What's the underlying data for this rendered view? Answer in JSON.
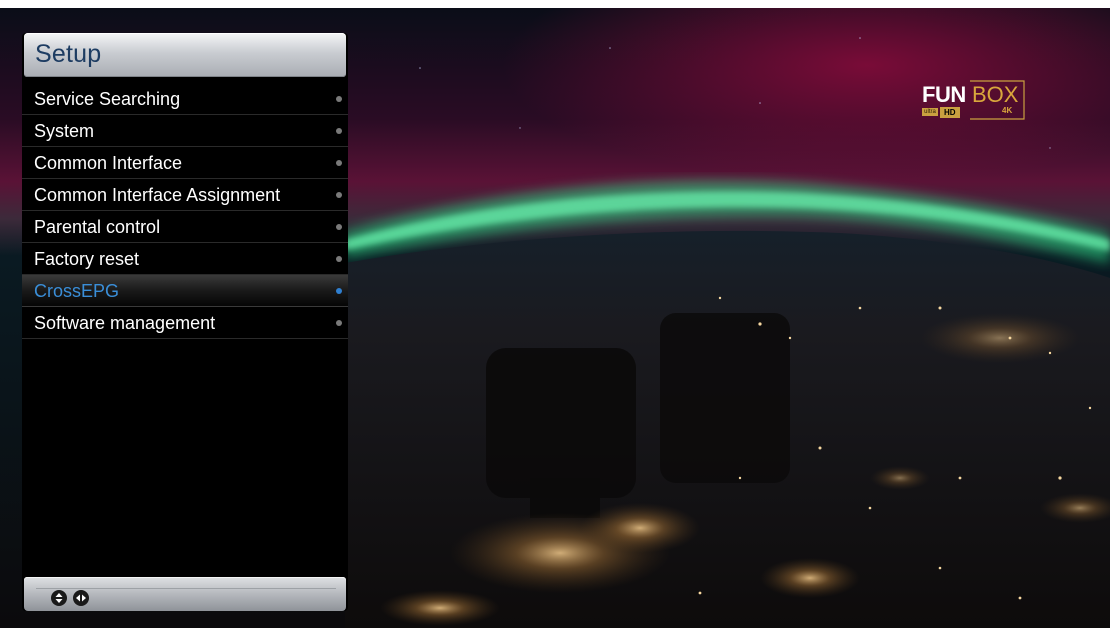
{
  "menu": {
    "title": "Setup",
    "items": [
      {
        "label": "Service Searching",
        "selected": false
      },
      {
        "label": "System",
        "selected": false
      },
      {
        "label": "Common Interface",
        "selected": false
      },
      {
        "label": "Common Interface Assignment",
        "selected": false
      },
      {
        "label": "Parental control",
        "selected": false
      },
      {
        "label": "Factory reset",
        "selected": false
      },
      {
        "label": "CrossEPG",
        "selected": true
      },
      {
        "label": "Software management",
        "selected": false
      }
    ],
    "footer_icons": [
      "up-down-arrows-icon",
      "left-right-arrows-icon"
    ]
  },
  "logo": {
    "fun": "FUN",
    "box": "BOX",
    "ultra": "ultra",
    "hd": "HD",
    "fourk": "4K"
  },
  "colors": {
    "title_text": "#1d3c62",
    "selected_text": "#3a8ed8",
    "aurora_green": "#3fe08a",
    "aurora_red": "#7a1038",
    "logo_gold": "#d9a73c"
  }
}
